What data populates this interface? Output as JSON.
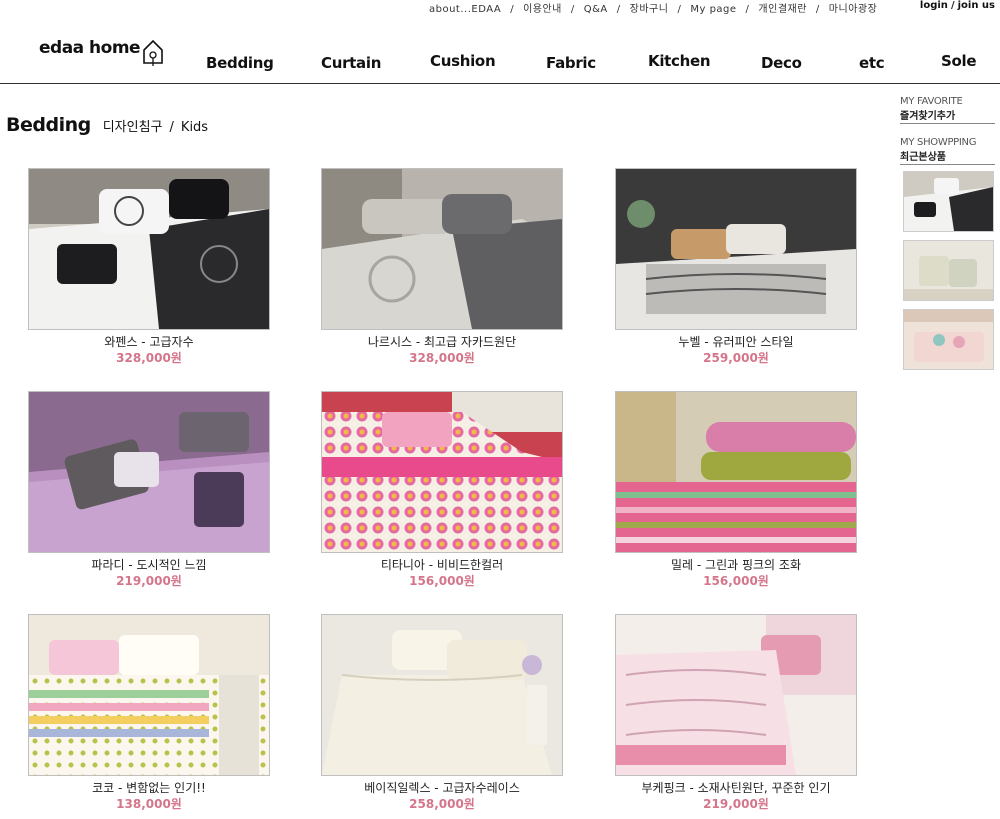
{
  "utility_links": [
    "about...EDAA",
    "이용안내",
    "Q&A",
    "장바구니",
    "My page",
    "개인결재란",
    "마니아광장"
  ],
  "auth": {
    "login": "login",
    "join": "join us",
    "separator": "/"
  },
  "logo": {
    "text": "edaa home"
  },
  "nav": [
    "Bedding",
    "Curtain",
    "Cushion",
    "Fabric",
    "Kitchen",
    "Deco",
    "etc",
    "Sole"
  ],
  "breadcrumb": {
    "title": "Bedding",
    "path": [
      "디자인침구",
      "Kids"
    ],
    "separator": "/"
  },
  "products": [
    {
      "name": "와펜스 - 고급자수",
      "price": "328,000원"
    },
    {
      "name": "나르시스 - 최고급 자카드원단",
      "price": "328,000원"
    },
    {
      "name": "누벨 - 유러피안 스타일",
      "price": "259,000원"
    },
    {
      "name": "파라디 - 도시적인 느낌",
      "price": "219,000원"
    },
    {
      "name": "티타니아 - 비비드한컬러",
      "price": "156,000원"
    },
    {
      "name": "밀레 - 그린과 핑크의 조화",
      "price": "156,000원"
    },
    {
      "name": "코코 - 변함없는 인기!!",
      "price": "138,000원"
    },
    {
      "name": "베이직일렉스 - 고급자수레이스",
      "price": "258,000원"
    },
    {
      "name": "부케핑크 - 소재사틴원단, 꾸준한 인기",
      "price": "219,000원"
    }
  ],
  "sidebar": {
    "favorite_label": "MY FAVORITE",
    "favorite_sub": "즐겨찾기추가",
    "shopping_label": "MY SHOWPPING",
    "shopping_sub": "최근본상품"
  },
  "colors": {
    "price": "#d4758a",
    "rule": "#333333"
  }
}
